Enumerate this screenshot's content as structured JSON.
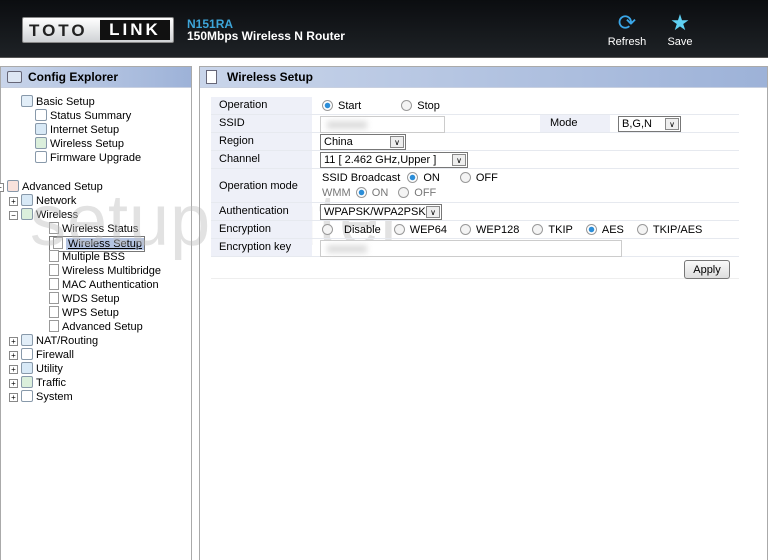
{
  "header": {
    "logo_left": "TOTO",
    "logo_right": "LINK",
    "model": "N151RA",
    "subtitle": "150Mbps Wireless N Router",
    "refresh": "Refresh",
    "save": "Save"
  },
  "watermark": "setuprouter",
  "sidebar": {
    "title": "Config Explorer",
    "items": [
      {
        "label": "Basic Setup"
      },
      {
        "label": "Status Summary"
      },
      {
        "label": "Internet Setup"
      },
      {
        "label": "Wireless Setup"
      },
      {
        "label": "Firmware Upgrade"
      },
      {
        "label": "Advanced Setup"
      },
      {
        "label": "Network"
      },
      {
        "label": "Wireless"
      },
      {
        "label": "Wireless Status"
      },
      {
        "label": "Wireless Setup"
      },
      {
        "label": "Multiple BSS"
      },
      {
        "label": "Wireless Multibridge"
      },
      {
        "label": "MAC Authentication"
      },
      {
        "label": "WDS Setup"
      },
      {
        "label": "WPS Setup"
      },
      {
        "label": "Advanced Setup"
      },
      {
        "label": "NAT/Routing"
      },
      {
        "label": "Firewall"
      },
      {
        "label": "Utility"
      },
      {
        "label": "Traffic"
      },
      {
        "label": "System"
      }
    ]
  },
  "main": {
    "title": "Wireless Setup",
    "operation": {
      "label": "Operation",
      "start": "Start",
      "stop": "Stop",
      "selected": "Start"
    },
    "ssid": {
      "label": "SSID",
      "value": ""
    },
    "mode": {
      "label": "Mode",
      "value": "B,G,N"
    },
    "region": {
      "label": "Region",
      "value": "China"
    },
    "channel": {
      "label": "Channel",
      "value": "11 [ 2.462 GHz,Upper ]"
    },
    "operation_mode": {
      "label": "Operation mode",
      "ssid_broadcast": "SSID Broadcast",
      "wmm": "WMM",
      "on": "ON",
      "off": "OFF",
      "ssid_broadcast_selected": "ON",
      "wmm_selected": "ON"
    },
    "authentication": {
      "label": "Authentication",
      "value": "WPAPSK/WPA2PSK"
    },
    "encryption": {
      "label": "Encryption",
      "options": [
        "Disable",
        "WEP64",
        "WEP128",
        "TKIP",
        "AES",
        "TKIP/AES"
      ],
      "selected": "AES"
    },
    "encryption_key": {
      "label": "Encryption key",
      "value": ""
    },
    "apply": "Apply"
  },
  "colors": {
    "accent": "#2c8ed8",
    "title_bar": "#9db2d8",
    "header_bg": "#0b0d10"
  }
}
